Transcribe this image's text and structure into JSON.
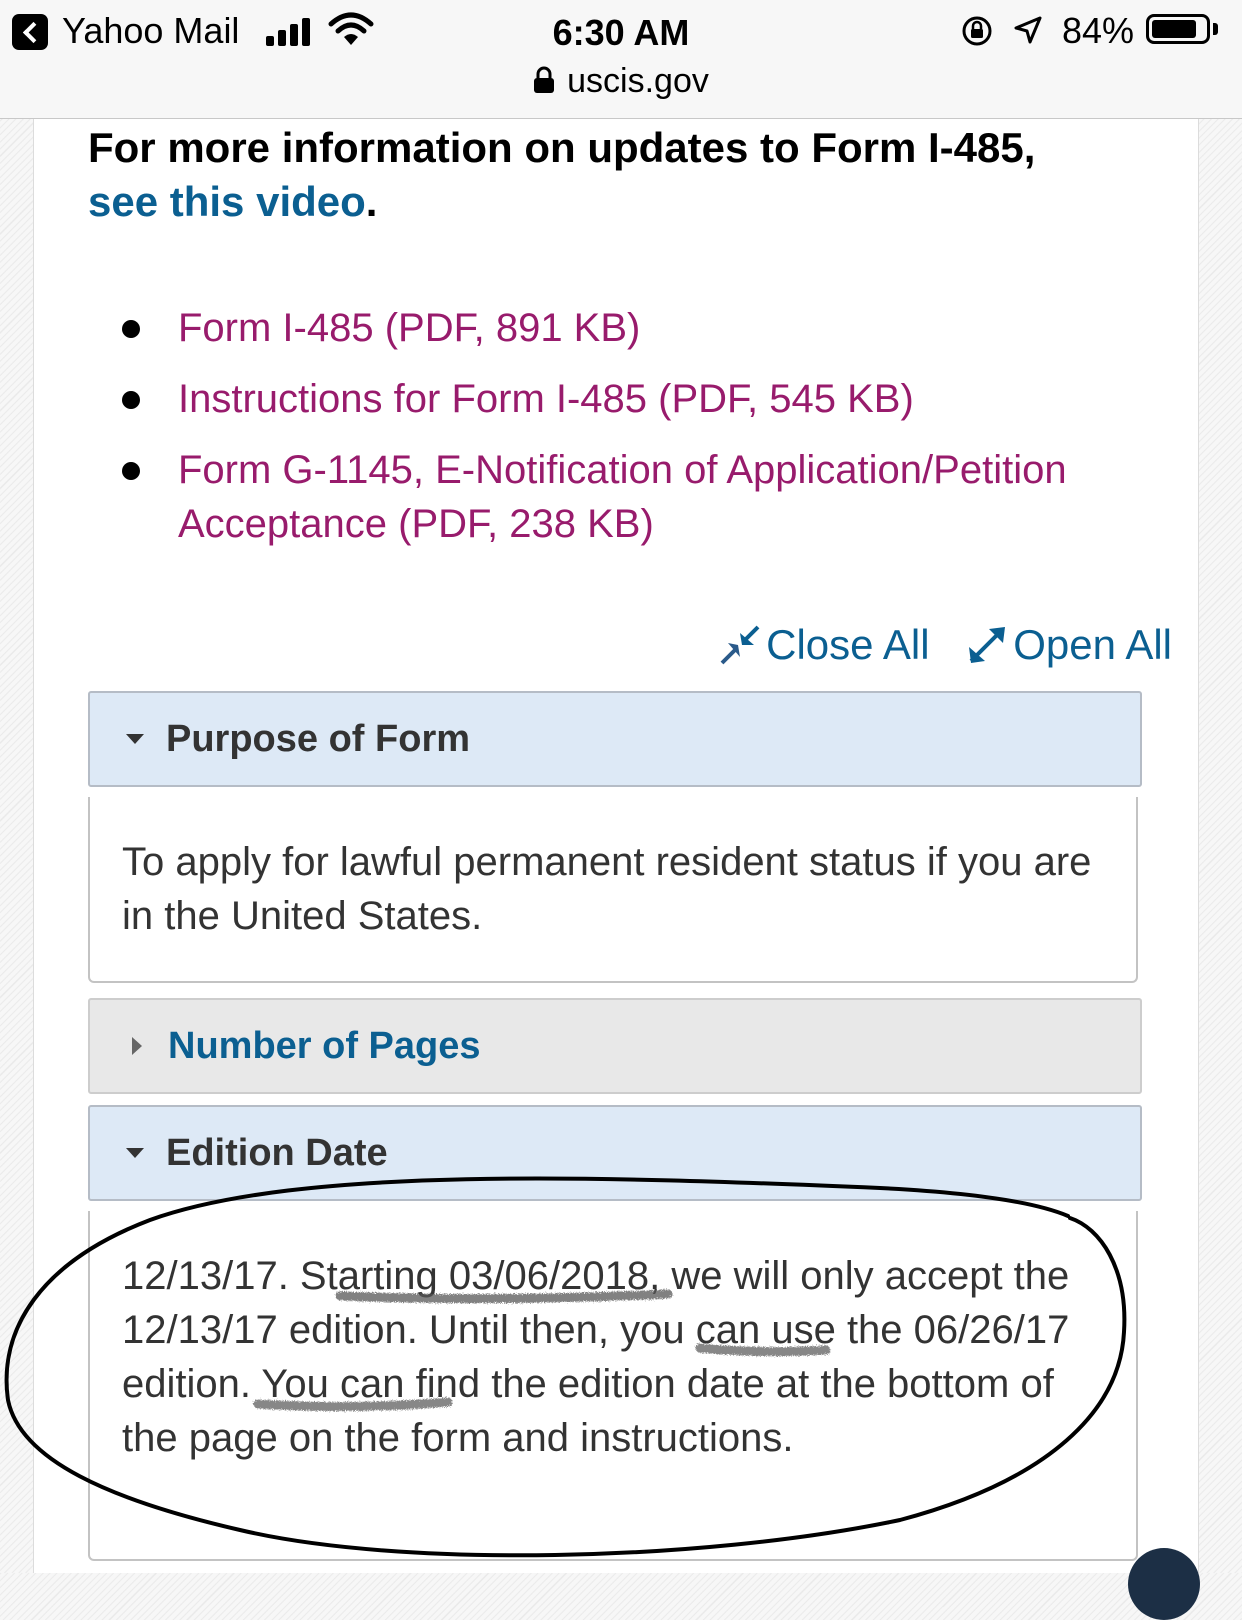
{
  "status_bar": {
    "back_app": "Yahoo Mail",
    "time": "6:30 AM",
    "domain": "uscis.gov",
    "battery": "84%",
    "battery_level": 0.84
  },
  "intro": {
    "text": "For more information on updates to Form I-485,",
    "link": "see this video",
    "suffix": "."
  },
  "links": [
    "Form I-485 (PDF, 891 KB)",
    "Instructions for Form I-485 (PDF, 545 KB)",
    "Form G-1145, E-Notification of Application/Petition Acceptance (PDF, 238 KB)"
  ],
  "controls": {
    "close_all": "Close All",
    "open_all": "Open All"
  },
  "accordion": {
    "purpose": {
      "title": "Purpose of Form",
      "body": "To apply for lawful permanent resident status if you are in the United States."
    },
    "pages": {
      "title": "Number of Pages"
    },
    "edition": {
      "title": "Edition Date",
      "body": "12/13/17. Starting 03/06/2018, we will only accept the 12/13/17 edition. Until then, you can use the 06/26/17 edition. You can find the edition date at the bottom of the page on the form and instructions."
    }
  },
  "colors": {
    "link_blue": "#0b5f91",
    "link_magenta": "#981b6c",
    "accordion_open_bg": "#dde9f6",
    "accordion_closed_bg": "#e8e8e8"
  }
}
